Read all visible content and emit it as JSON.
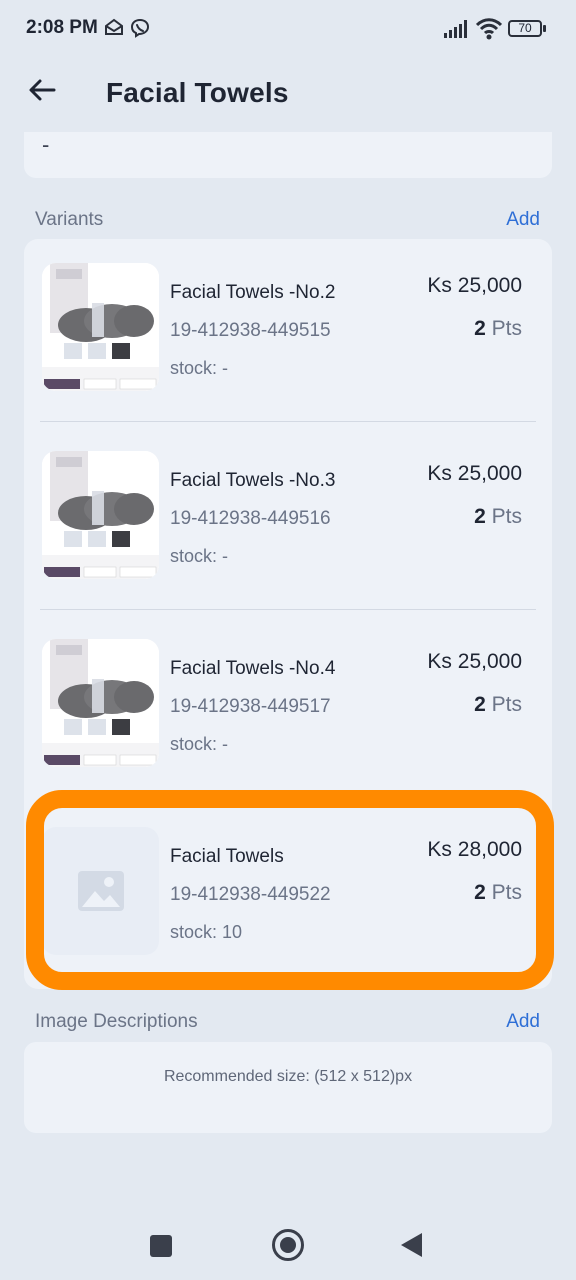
{
  "status_bar": {
    "time": "2:08 PM",
    "battery": "70",
    "icons": [
      "mail-icon",
      "viber-icon",
      "signal-icon",
      "wifi-icon",
      "battery-icon"
    ]
  },
  "app_bar": {
    "title": "Facial Towels",
    "back_icon": "arrow-left-icon"
  },
  "top_card": {
    "value": "-"
  },
  "variants_section": {
    "label": "Variants",
    "add_label": "Add",
    "items": [
      {
        "name": "Facial Towels -No.2",
        "sku": "19-412938-449515",
        "stock": "stock: -",
        "price": "Ks 25,000",
        "points_value": "2",
        "points_unit": "Pts",
        "image": "towel-product-photo"
      },
      {
        "name": "Facial Towels -No.3",
        "sku": "19-412938-449516",
        "stock": "stock: -",
        "price": "Ks 25,000",
        "points_value": "2",
        "points_unit": "Pts",
        "image": "towel-product-photo"
      },
      {
        "name": "Facial Towels -No.4",
        "sku": "19-412938-449517",
        "stock": "stock: -",
        "price": "Ks 25,000",
        "points_value": "2",
        "points_unit": "Pts",
        "image": "towel-product-photo"
      },
      {
        "name": "Facial Towels",
        "sku": "19-412938-449522",
        "stock": "stock: 10",
        "price": "Ks 28,000",
        "points_value": "2",
        "points_unit": "Pts",
        "image": "image-placeholder-icon"
      }
    ]
  },
  "image_descriptions": {
    "label": "Image Descriptions",
    "add_label": "Add",
    "hint": "Recommended size: (512 x 512)px"
  },
  "colors": {
    "background": "#e3e9f1",
    "card": "#eef2f8",
    "accent_link": "#2f6fd6",
    "highlight": "#ff8a00",
    "text_primary": "#1f2533",
    "text_secondary": "#6b7487"
  }
}
